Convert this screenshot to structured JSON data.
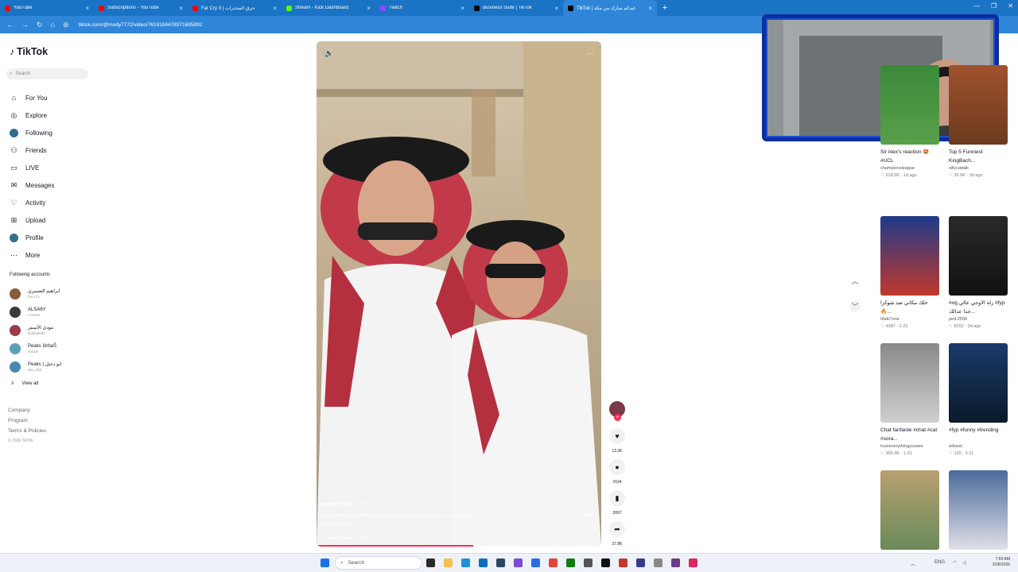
{
  "browser": {
    "tabs": [
      {
        "title": "YouTube",
        "color": "#ff0000"
      },
      {
        "title": "Subscriptions - YouTube",
        "color": "#ff0000"
      },
      {
        "title": "Far Cry 3 | حرق المخدرات",
        "color": "#ff0000"
      },
      {
        "title": "Stream - Kick Dashboard",
        "color": "#53fc18"
      },
      {
        "title": "Twitch",
        "color": "#9146ff"
      },
      {
        "title": "Business Suite | TikTok",
        "color": "#000000"
      },
      {
        "title": "TikTok | عيدكم مبارك من مكة",
        "color": "#000000"
      }
    ],
    "url": "tiktok.com/@mody7772/video/7619184478371695892"
  },
  "sidebar": {
    "logo": "TikTok",
    "search_placeholder": "Search",
    "nav": [
      {
        "label": "For You",
        "icon": "home-icon"
      },
      {
        "label": "Explore",
        "icon": "compass-icon"
      },
      {
        "label": "Following",
        "icon": "following-avatar-icon"
      },
      {
        "label": "Friends",
        "icon": "friends-icon"
      },
      {
        "label": "LIVE",
        "icon": "live-icon"
      },
      {
        "label": "Messages",
        "icon": "messages-icon"
      },
      {
        "label": "Activity",
        "icon": "activity-icon"
      },
      {
        "label": "Upload",
        "icon": "upload-icon"
      },
      {
        "label": "Profile",
        "icon": "profile-icon"
      },
      {
        "label": "More",
        "icon": "more-icon"
      }
    ],
    "following_header": "Following accounts",
    "accounts": [
      {
        "name": "ابراهيم العسيري",
        "sub": "iba.171",
        "color": "#8a5a3a"
      },
      {
        "name": "ALSA6Y",
        "sub": "v7ntnss",
        "color": "#3a3a3a"
      },
      {
        "name": "مودي الأسمر",
        "sub": "binkhaled0",
        "color": "#9a3a4a"
      },
      {
        "name": "Peaks ïörbaŠ",
        "sub": "iörbaS",
        "color": "#5aa0b8"
      },
      {
        "name": "Peaks | ابو دخيل",
        "sub": "abu_dkh",
        "color": "#4a8ab0"
      }
    ],
    "view_all": "View all",
    "footer": [
      "Company",
      "Program",
      "Terms & Policies"
    ],
    "copyright": "© 2026 TikTok"
  },
  "video": {
    "author": "mody7772",
    "date": "3-20",
    "caption": "عيدكم مبارك من مكة #عيد_سعيد #كل عام وانتم بخير جميعاً #الرياض #fyp #اكسبلور",
    "more": "more",
    "see_translation": "See translation",
    "sound": "الصوت الأصلي - zrrt_7",
    "progress": 0.55
  },
  "actions": {
    "likes": "13.2K",
    "comments": "1524",
    "saves": "2007",
    "shares": "27.8K"
  },
  "grid": [
    {
      "title": "Sir Alex's reaction 🤩 #UCL",
      "author": "championsleague",
      "views": "518.5K",
      "date": "1d ago",
      "bg": "linear-gradient(180deg,#3a8a3a,#5aa04a)"
    },
    {
      "title": "Top 5 Funniest KingBach...",
      "author": "sillycattalk",
      "views": "20.6K",
      "date": "3d ago",
      "bg": "linear-gradient(180deg,#a0522d,#6b3a1e)"
    },
    {
      "title": "خلك مكاني ضد شوكزا 🔥...",
      "author": "0taki7one",
      "views": "4387",
      "date": "2-21",
      "bg": "linear-gradient(180deg,#1e3a8a,#c0392b)"
    },
    {
      "title": "#og زلة الاوجي عالي #fyp جدا عدالك...",
      "author": "ped.2558",
      "views": "8152",
      "date": "2d ago",
      "bg": "linear-gradient(180deg,#2a2a2a,#111)"
    },
    {
      "title": "Chat fanfarde #chat #cat #sora...",
      "author": "trusteverythingyousee",
      "views": "356.3K",
      "date": "1-31",
      "bg": "linear-gradient(180deg,#8a8a8a,#cfcfcf)"
    },
    {
      "title": "#fyp #funny #trending",
      "author": "ediwok",
      "views": "120",
      "date": "3-11",
      "bg": "linear-gradient(180deg,#1a3a6a,#0a1a2a)"
    },
    {
      "title": "",
      "author": "",
      "views": "",
      "date": "",
      "bg": "linear-gradient(180deg,#b8a070,#6a8a5a)"
    },
    {
      "title": "",
      "author": "",
      "views": "",
      "date": "",
      "bg": "linear-gradient(180deg,#4a6a9a,#e0e0e8)"
    }
  ],
  "taskbar": {
    "search_placeholder": "Search",
    "lang": "ENG",
    "time": "7:59 AM",
    "date": "3/28/2026"
  }
}
